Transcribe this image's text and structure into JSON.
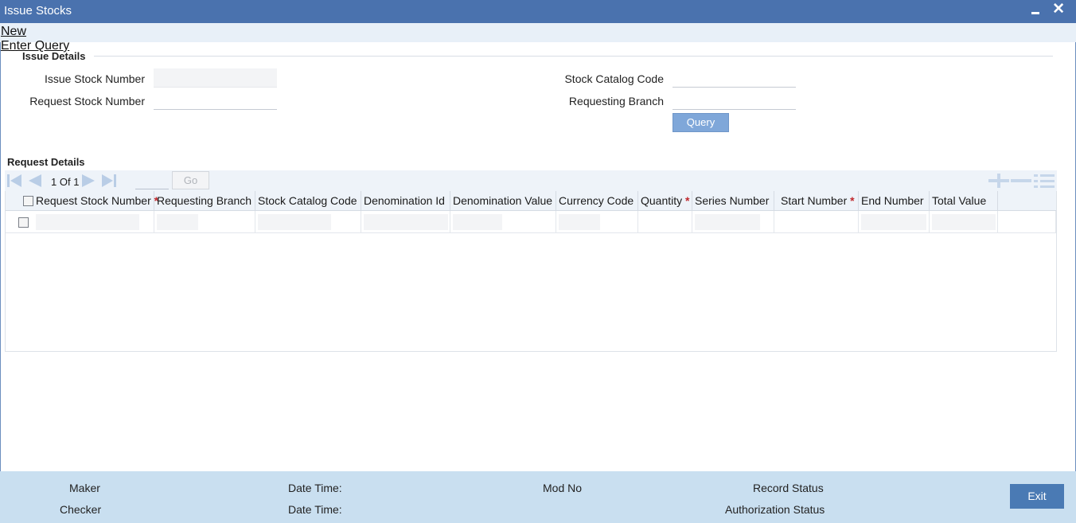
{
  "window": {
    "title": "Issue Stocks",
    "minimize_label": "",
    "close_label": "✕"
  },
  "menu": {
    "new_label": "New",
    "enter_query_label": "Enter Query"
  },
  "issue_details": {
    "legend": "Issue Details",
    "issue_stock_number_label": "Issue Stock Number",
    "request_stock_number_label": "Request Stock Number",
    "stock_catalog_code_label": "Stock Catalog Code",
    "requesting_branch_label": "Requesting Branch",
    "query_button": "Query"
  },
  "request_details": {
    "title": "Request Details",
    "pager": {
      "current": "1",
      "of_label": "Of",
      "total": "1",
      "go_label": "Go"
    },
    "columns": [
      {
        "label": "Request Stock Number",
        "required": true
      },
      {
        "label": "Requesting Branch",
        "required": false
      },
      {
        "label": "Stock Catalog Code",
        "required": false
      },
      {
        "label": "Denomination Id",
        "required": false
      },
      {
        "label": "Denomination Value",
        "required": false
      },
      {
        "label": "Currency Code",
        "required": false
      },
      {
        "label": "Quantity",
        "required": true
      },
      {
        "label": "Series Number",
        "required": false
      },
      {
        "label": "Start Number",
        "required": true
      },
      {
        "label": "End Number",
        "required": false
      },
      {
        "label": "Total Value",
        "required": false
      }
    ],
    "required_marker": "*"
  },
  "footer": {
    "maker_label": "Maker",
    "checker_label": "Checker",
    "date_time_label_1": "Date Time:",
    "date_time_label_2": "Date Time:",
    "mod_no_label": "Mod No",
    "record_status_label": "Record Status",
    "authorization_status_label": "Authorization Status",
    "exit_button": "Exit"
  },
  "colors": {
    "title_bar": "#4a72ae",
    "footer": "#c9dff0",
    "accent_button": "#4a7ab4",
    "required": "#c0282d"
  }
}
